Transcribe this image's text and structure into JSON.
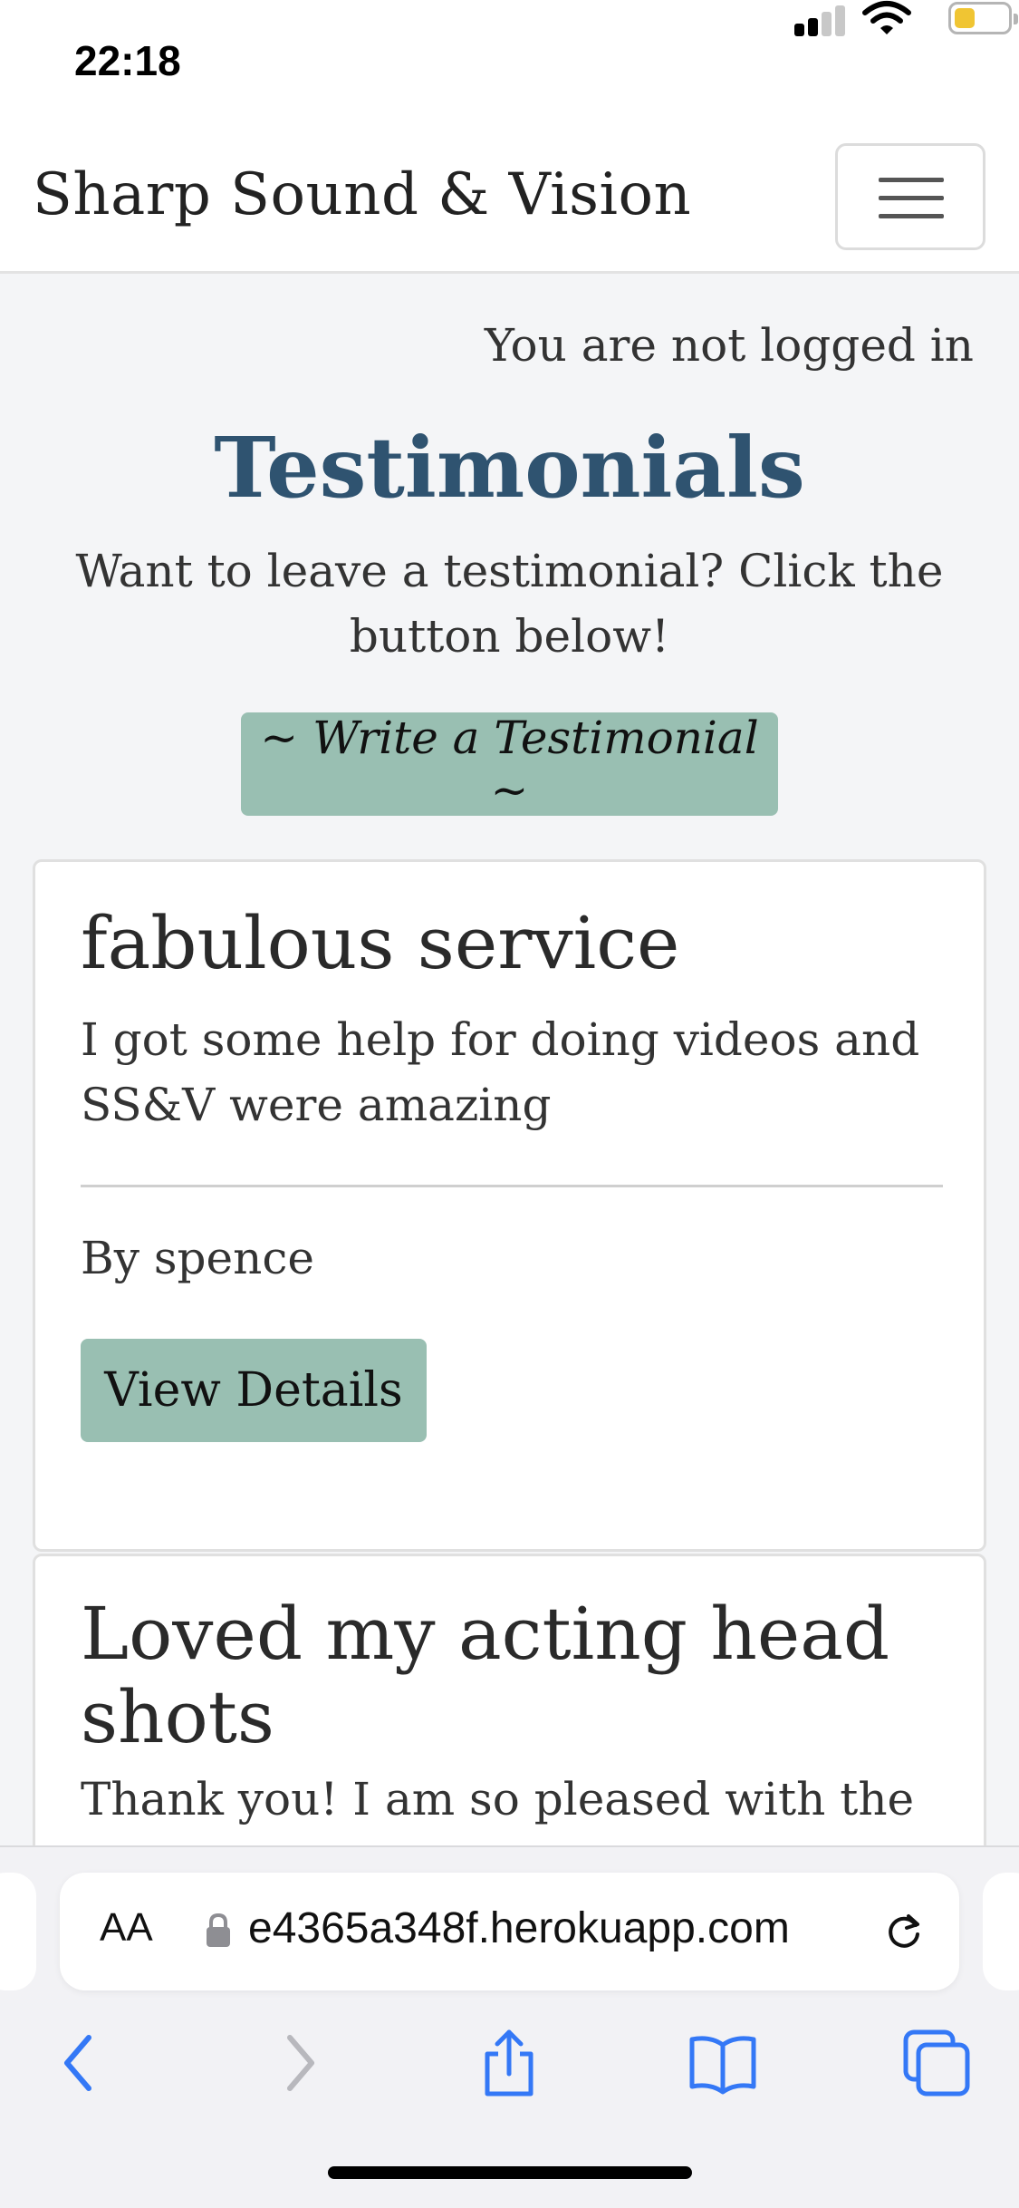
{
  "status_bar": {
    "time": "22:18",
    "icons": [
      "signal-icon",
      "wifi-icon",
      "battery-icon"
    ],
    "battery_color": "#f0c533"
  },
  "navbar": {
    "brand": "Sharp Sound & Vision",
    "menu_icon": "hamburger-menu-icon"
  },
  "main": {
    "login_status": "You are not logged in",
    "title": "Testimonials",
    "intro": "Want to leave a testimonial? Click the button below!",
    "write_button": "~ Write a Testimonial ~",
    "testimonials": [
      {
        "title": "fabulous service",
        "body": "I got some help for doing videos and SS&V were amazing",
        "author": "By spence",
        "button": "View Details"
      },
      {
        "title": "Loved my acting head shots",
        "body": "Thank you! I am so pleased with the"
      }
    ]
  },
  "browser": {
    "text_size_label": "AA",
    "url": "e4365a348f.herokuapp.com",
    "icons": [
      "lock-icon",
      "reload-icon",
      "back-icon",
      "forward-icon",
      "share-icon",
      "bookmarks-icon",
      "tabs-icon"
    ]
  },
  "colors": {
    "accent_button": "#99bfb2",
    "title": "#2f5370",
    "browser_blue": "#3478f6"
  }
}
